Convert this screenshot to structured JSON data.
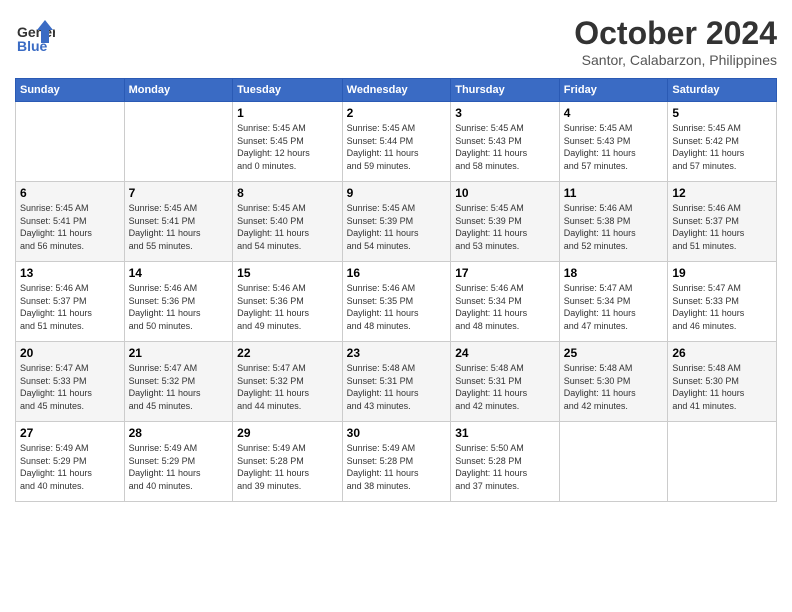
{
  "logo": {
    "line1": "General",
    "line2": "Blue"
  },
  "title": "October 2024",
  "subtitle": "Santor, Calabarzon, Philippines",
  "days_of_week": [
    "Sunday",
    "Monday",
    "Tuesday",
    "Wednesday",
    "Thursday",
    "Friday",
    "Saturday"
  ],
  "weeks": [
    [
      {
        "day": "",
        "info": ""
      },
      {
        "day": "",
        "info": ""
      },
      {
        "day": "1",
        "info": "Sunrise: 5:45 AM\nSunset: 5:45 PM\nDaylight: 12 hours\nand 0 minutes."
      },
      {
        "day": "2",
        "info": "Sunrise: 5:45 AM\nSunset: 5:44 PM\nDaylight: 11 hours\nand 59 minutes."
      },
      {
        "day": "3",
        "info": "Sunrise: 5:45 AM\nSunset: 5:43 PM\nDaylight: 11 hours\nand 58 minutes."
      },
      {
        "day": "4",
        "info": "Sunrise: 5:45 AM\nSunset: 5:43 PM\nDaylight: 11 hours\nand 57 minutes."
      },
      {
        "day": "5",
        "info": "Sunrise: 5:45 AM\nSunset: 5:42 PM\nDaylight: 11 hours\nand 57 minutes."
      }
    ],
    [
      {
        "day": "6",
        "info": "Sunrise: 5:45 AM\nSunset: 5:41 PM\nDaylight: 11 hours\nand 56 minutes."
      },
      {
        "day": "7",
        "info": "Sunrise: 5:45 AM\nSunset: 5:41 PM\nDaylight: 11 hours\nand 55 minutes."
      },
      {
        "day": "8",
        "info": "Sunrise: 5:45 AM\nSunset: 5:40 PM\nDaylight: 11 hours\nand 54 minutes."
      },
      {
        "day": "9",
        "info": "Sunrise: 5:45 AM\nSunset: 5:39 PM\nDaylight: 11 hours\nand 54 minutes."
      },
      {
        "day": "10",
        "info": "Sunrise: 5:45 AM\nSunset: 5:39 PM\nDaylight: 11 hours\nand 53 minutes."
      },
      {
        "day": "11",
        "info": "Sunrise: 5:46 AM\nSunset: 5:38 PM\nDaylight: 11 hours\nand 52 minutes."
      },
      {
        "day": "12",
        "info": "Sunrise: 5:46 AM\nSunset: 5:37 PM\nDaylight: 11 hours\nand 51 minutes."
      }
    ],
    [
      {
        "day": "13",
        "info": "Sunrise: 5:46 AM\nSunset: 5:37 PM\nDaylight: 11 hours\nand 51 minutes."
      },
      {
        "day": "14",
        "info": "Sunrise: 5:46 AM\nSunset: 5:36 PM\nDaylight: 11 hours\nand 50 minutes."
      },
      {
        "day": "15",
        "info": "Sunrise: 5:46 AM\nSunset: 5:36 PM\nDaylight: 11 hours\nand 49 minutes."
      },
      {
        "day": "16",
        "info": "Sunrise: 5:46 AM\nSunset: 5:35 PM\nDaylight: 11 hours\nand 48 minutes."
      },
      {
        "day": "17",
        "info": "Sunrise: 5:46 AM\nSunset: 5:34 PM\nDaylight: 11 hours\nand 48 minutes."
      },
      {
        "day": "18",
        "info": "Sunrise: 5:47 AM\nSunset: 5:34 PM\nDaylight: 11 hours\nand 47 minutes."
      },
      {
        "day": "19",
        "info": "Sunrise: 5:47 AM\nSunset: 5:33 PM\nDaylight: 11 hours\nand 46 minutes."
      }
    ],
    [
      {
        "day": "20",
        "info": "Sunrise: 5:47 AM\nSunset: 5:33 PM\nDaylight: 11 hours\nand 45 minutes."
      },
      {
        "day": "21",
        "info": "Sunrise: 5:47 AM\nSunset: 5:32 PM\nDaylight: 11 hours\nand 45 minutes."
      },
      {
        "day": "22",
        "info": "Sunrise: 5:47 AM\nSunset: 5:32 PM\nDaylight: 11 hours\nand 44 minutes."
      },
      {
        "day": "23",
        "info": "Sunrise: 5:48 AM\nSunset: 5:31 PM\nDaylight: 11 hours\nand 43 minutes."
      },
      {
        "day": "24",
        "info": "Sunrise: 5:48 AM\nSunset: 5:31 PM\nDaylight: 11 hours\nand 42 minutes."
      },
      {
        "day": "25",
        "info": "Sunrise: 5:48 AM\nSunset: 5:30 PM\nDaylight: 11 hours\nand 42 minutes."
      },
      {
        "day": "26",
        "info": "Sunrise: 5:48 AM\nSunset: 5:30 PM\nDaylight: 11 hours\nand 41 minutes."
      }
    ],
    [
      {
        "day": "27",
        "info": "Sunrise: 5:49 AM\nSunset: 5:29 PM\nDaylight: 11 hours\nand 40 minutes."
      },
      {
        "day": "28",
        "info": "Sunrise: 5:49 AM\nSunset: 5:29 PM\nDaylight: 11 hours\nand 40 minutes."
      },
      {
        "day": "29",
        "info": "Sunrise: 5:49 AM\nSunset: 5:28 PM\nDaylight: 11 hours\nand 39 minutes."
      },
      {
        "day": "30",
        "info": "Sunrise: 5:49 AM\nSunset: 5:28 PM\nDaylight: 11 hours\nand 38 minutes."
      },
      {
        "day": "31",
        "info": "Sunrise: 5:50 AM\nSunset: 5:28 PM\nDaylight: 11 hours\nand 37 minutes."
      },
      {
        "day": "",
        "info": ""
      },
      {
        "day": "",
        "info": ""
      }
    ]
  ]
}
